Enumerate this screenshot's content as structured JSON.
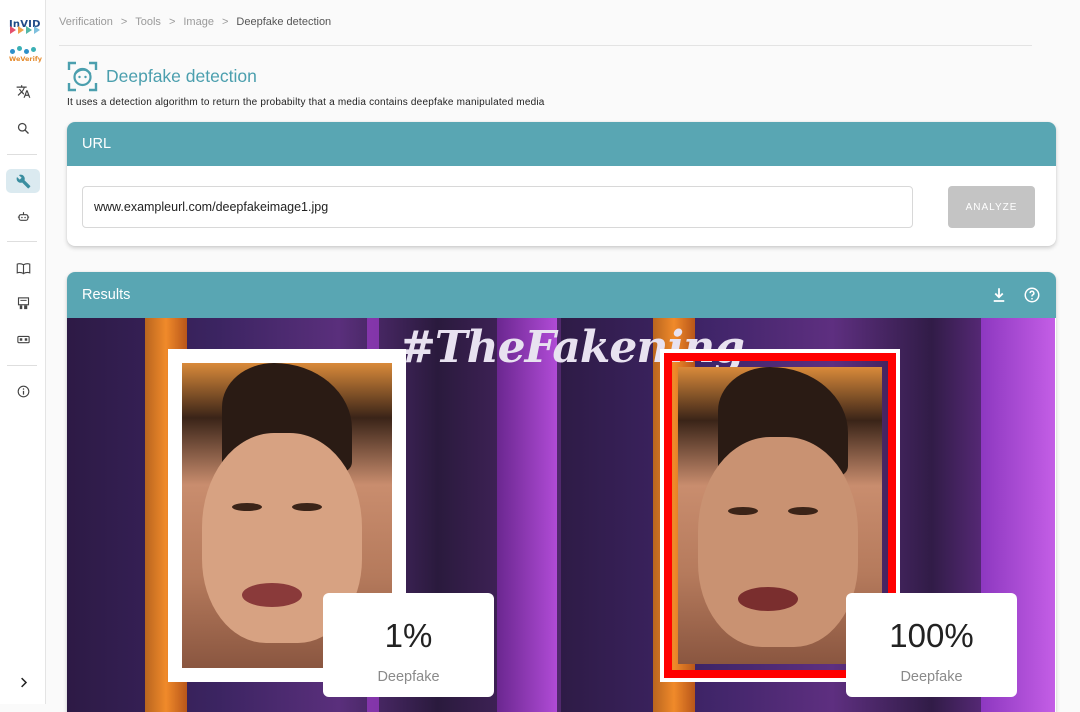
{
  "sidebar": {
    "logo_top": "InVID",
    "logo_bottom": "WeVerify",
    "icons": [
      "translate-icon",
      "search-icon",
      "wrench-icon",
      "robot-icon",
      "book-icon",
      "classroom-icon",
      "ticket-icon",
      "info-icon",
      "chevron-right-icon"
    ]
  },
  "breadcrumb": {
    "items": [
      "Verification",
      "Tools",
      "Image"
    ],
    "separator": ">",
    "current": "Deepfake detection"
  },
  "page": {
    "title": "Deepfake detection",
    "subtitle": "It uses a detection algorithm to return the probabilty that a media contains deepfake manipulated media"
  },
  "url_card": {
    "header": "URL",
    "input_value": "www.exampleurl.com/deepfakeimage1.jpg",
    "analyze_label": "ANALYZE"
  },
  "results": {
    "header": "Results",
    "image_caption": "#TheFakening",
    "faces": [
      {
        "percent": "1%",
        "label": "Deepfake"
      },
      {
        "percent": "100%",
        "label": "Deepfake"
      }
    ]
  },
  "colors": {
    "accent": "#59a6b3",
    "title": "#4b9fae",
    "flag_red": "#ff0000"
  }
}
